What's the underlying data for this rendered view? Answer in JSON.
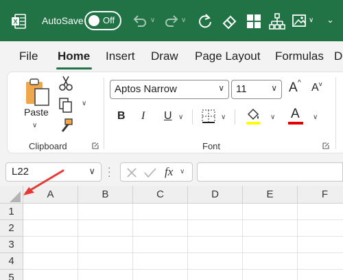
{
  "titlebar": {
    "autosave_label": "AutoSave",
    "autosave_state": "Off",
    "accent": "#217346"
  },
  "tabs": [
    "File",
    "Home",
    "Insert",
    "Draw",
    "Page Layout",
    "Formulas",
    "D"
  ],
  "active_tab": "Home",
  "ribbon": {
    "clipboard": {
      "paste_label": "Paste",
      "group_label": "Clipboard"
    },
    "font": {
      "font_name": "Aptos Narrow",
      "font_size": "11",
      "group_label": "Font",
      "bold": "B",
      "italic": "I",
      "underline": "U",
      "grow": "A",
      "shrink": "A",
      "font_color_letter": "A",
      "highlight_color": "#ffff00",
      "font_color": "#e00000"
    }
  },
  "formula_bar": {
    "name_box": "L22",
    "fx": "fx",
    "formula": ""
  },
  "grid": {
    "columns": [
      "A",
      "B",
      "C",
      "D",
      "E",
      "F"
    ],
    "rows": [
      "1",
      "2",
      "3",
      "4",
      "5"
    ]
  },
  "annotation": {
    "arrow_color": "#e53935"
  }
}
